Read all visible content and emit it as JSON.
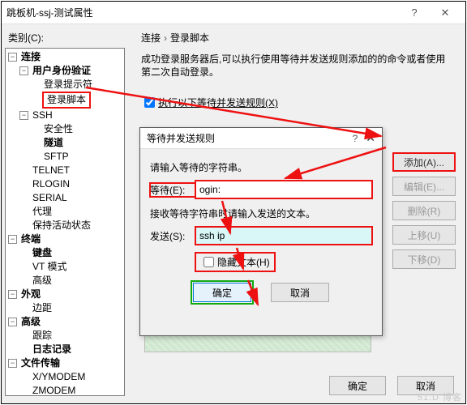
{
  "window": {
    "title": "跳板机-ssj-测试属性",
    "help": "?",
    "close": "✕"
  },
  "category_label": "类别(C):",
  "tree": {
    "n0": "连接",
    "n0_0": "用户身份验证",
    "n0_0_0": "登录提示符",
    "n0_0_1": "登录脚本",
    "n0_1": "SSH",
    "n0_1_0": "安全性",
    "n0_1_1": "隧道",
    "n0_1_2": "SFTP",
    "n0_2": "TELNET",
    "n0_3": "RLOGIN",
    "n0_4": "SERIAL",
    "n0_5": "代理",
    "n0_6": "保持活动状态",
    "n1": "终端",
    "n1_0": "键盘",
    "n1_1": "VT 模式",
    "n1_2": "高级",
    "n2": "外观",
    "n2_0": "边距",
    "n3": "高级",
    "n3_0": "跟踪",
    "n3_1": "日志记录",
    "n4": "文件传输",
    "n4_0": "X/YMODEM",
    "n4_1": "ZMODEM"
  },
  "crumbs": {
    "a": "连接",
    "b": "登录脚本"
  },
  "desc": "成功登录服务器后,可以执行使用等待并发送规则添加的的命令或者使用第二次自动登录。",
  "exec_label": "执行以下等待并发送规则(X)",
  "buttons": {
    "add": "添加(A)...",
    "edit": "编辑(E)...",
    "del": "删除(R)",
    "up": "上移(U)",
    "down": "下移(D)",
    "ok": "确定",
    "cancel": "取消"
  },
  "dialog": {
    "title": "等待并发送规则",
    "p1": "请输入等待的字符串。",
    "wait_label": "等待(E):",
    "wait_value": "ogin:",
    "p2": "接收等待字符串时请输入发送的文本。",
    "send_label": "发送(S):",
    "send_value": "ssh ip",
    "hide_label": "隐藏文本(H)",
    "ok": "确定",
    "cancel": "取消"
  },
  "watermark": "51.D 博客"
}
